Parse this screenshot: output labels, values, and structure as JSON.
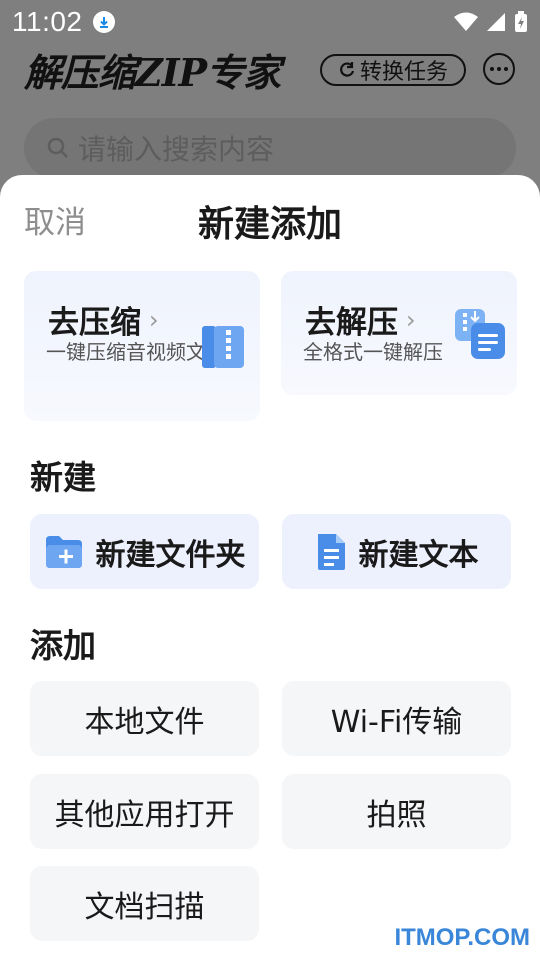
{
  "status_bar": {
    "time": "11:02",
    "icons": [
      "download-icon",
      "wifi-icon",
      "signal-icon",
      "battery-icon"
    ]
  },
  "app": {
    "title": "解压缩ZIP专家",
    "convert_button": "转换任务",
    "search_placeholder": "请输入搜索内容"
  },
  "sheet": {
    "cancel_label": "取消",
    "title": "新建添加",
    "features": [
      {
        "title": "去压缩",
        "description": "一键压缩音视频文",
        "icon": "zip-book-icon"
      },
      {
        "title": "去解压",
        "description": "全格式一键解压",
        "icon": "unzip-file-icon"
      }
    ],
    "new_section_title": "新建",
    "new_items": [
      {
        "label": "新建文件夹",
        "icon": "new-folder-icon"
      },
      {
        "label": "新建文本",
        "icon": "new-text-icon"
      }
    ],
    "add_section_title": "添加",
    "add_items": [
      {
        "label": "本地文件"
      },
      {
        "label": "Wi-Fi传输"
      },
      {
        "label": "其他应用打开"
      },
      {
        "label": "拍照"
      },
      {
        "label": "文档扫描"
      }
    ]
  },
  "colors": {
    "accent_blue": "#4a8de8",
    "card_bg": "#eff3fd",
    "button_bg": "#f5f6f8",
    "watermark": "#3a86d8"
  },
  "watermark": "ITMOP.COM"
}
